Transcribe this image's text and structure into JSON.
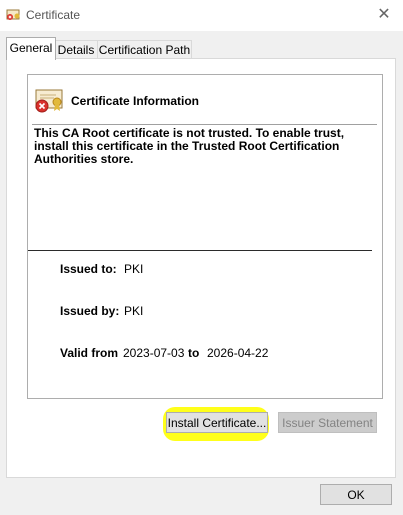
{
  "window": {
    "title": "Certificate",
    "close_icon": "close-icon",
    "app_icon": "certificate-icon"
  },
  "tabs": [
    {
      "label": "General",
      "active": true
    },
    {
      "label": "Details",
      "active": false
    },
    {
      "label": "Certification Path",
      "active": false
    }
  ],
  "info": {
    "heading": "Certificate Information",
    "message": "This CA Root certificate is not trusted. To enable trust, install this certificate in the Trusted Root Certification Authorities store.",
    "icon": "untrusted-certificate-icon"
  },
  "fields": {
    "issued_to_label": "Issued to:",
    "issued_to_value": "PKI",
    "issued_by_label": "Issued by:",
    "issued_by_value": "PKI",
    "valid_from_label": "Valid from",
    "valid_from_value": "2023-07-03",
    "to_label": "to",
    "valid_to_value": "2026-04-22"
  },
  "buttons": {
    "install": "Install Certificate...",
    "issuer_statement": "Issuer Statement",
    "ok": "OK"
  },
  "colors": {
    "highlight": "#ffff1a",
    "panel": "#ffffff",
    "window": "#f0f0f0"
  }
}
